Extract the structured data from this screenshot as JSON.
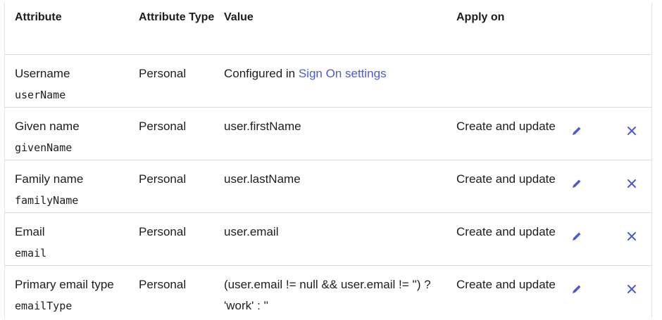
{
  "table": {
    "headers": {
      "attribute": "Attribute",
      "attribute_type": "Attribute Type",
      "value": "Value",
      "apply_on": "Apply on"
    },
    "rows": [
      {
        "name": "Username",
        "var": "userName",
        "type": "Personal",
        "value_prefix": "Configured in ",
        "value_link": "Sign On settings",
        "apply_on": ""
      },
      {
        "name": "Given name",
        "var": "givenName",
        "type": "Personal",
        "value": "user.firstName",
        "apply_on": "Create and update"
      },
      {
        "name": "Family name",
        "var": "familyName",
        "type": "Personal",
        "value": "user.lastName",
        "apply_on": "Create and update"
      },
      {
        "name": "Email",
        "var": "email",
        "type": "Personal",
        "value": "user.email",
        "apply_on": "Create and update"
      },
      {
        "name": "Primary email type",
        "var": "emailType",
        "type": "Personal",
        "value": "(user.email != null && user.email != '') ? 'work' : ''",
        "apply_on": "Create and update"
      }
    ]
  },
  "icons": {
    "edit": "pencil-icon",
    "delete": "close-icon",
    "accent": "#4c5bd4"
  }
}
